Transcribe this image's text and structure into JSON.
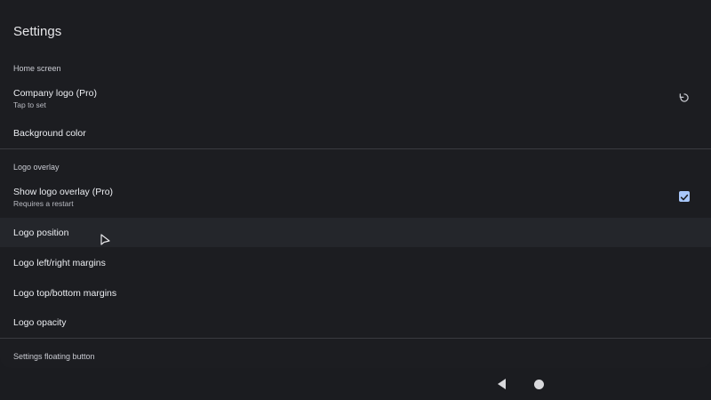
{
  "page_title": "Settings",
  "sections": {
    "home_screen": "Home screen",
    "logo_overlay": "Logo overlay",
    "settings_floating_button": "Settings floating button"
  },
  "items": {
    "company_logo": {
      "title": "Company logo (Pro)",
      "summary": "Tap to set",
      "icon": "reset-icon"
    },
    "background_color": {
      "title": "Background color"
    },
    "show_logo_overlay": {
      "title": "Show logo overlay (Pro)",
      "summary": "Requires a restart",
      "checked": true
    },
    "logo_position": {
      "title": "Logo position"
    },
    "logo_lr_margins": {
      "title": "Logo left/right margins"
    },
    "logo_tb_margins": {
      "title": "Logo top/bottom margins"
    },
    "logo_opacity": {
      "title": "Logo opacity"
    }
  },
  "navigation_bar": {
    "back": "back-icon",
    "home": "home-icon"
  },
  "colors": {
    "accent": "#a8c7fa",
    "background": "#1c1d21",
    "highlight": "#24262b"
  }
}
